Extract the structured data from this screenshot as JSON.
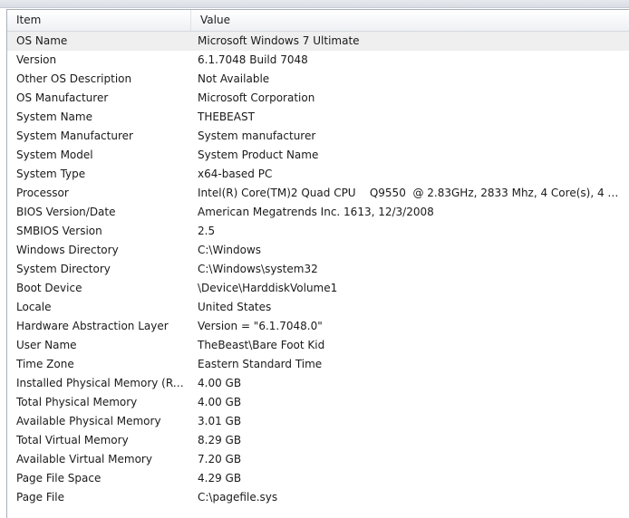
{
  "columns": {
    "item": "Item",
    "value": "Value"
  },
  "rows": [
    {
      "item": "OS Name",
      "value": "Microsoft Windows 7 Ultimate"
    },
    {
      "item": "Version",
      "value": "6.1.7048 Build 7048"
    },
    {
      "item": "Other OS Description",
      "value": "Not Available"
    },
    {
      "item": "OS Manufacturer",
      "value": "Microsoft Corporation"
    },
    {
      "item": "System Name",
      "value": "THEBEAST"
    },
    {
      "item": "System Manufacturer",
      "value": "System manufacturer"
    },
    {
      "item": "System Model",
      "value": "System Product Name"
    },
    {
      "item": "System Type",
      "value": "x64-based PC"
    },
    {
      "item": "Processor",
      "value": "Intel(R) Core(TM)2 Quad CPU    Q9550  @ 2.83GHz, 2833 Mhz, 4 Core(s), 4 Lo..."
    },
    {
      "item": "BIOS Version/Date",
      "value": "American Megatrends Inc. 1613, 12/3/2008"
    },
    {
      "item": "SMBIOS Version",
      "value": "2.5"
    },
    {
      "item": "Windows Directory",
      "value": "C:\\Windows"
    },
    {
      "item": "System Directory",
      "value": "C:\\Windows\\system32"
    },
    {
      "item": "Boot Device",
      "value": "\\Device\\HarddiskVolume1"
    },
    {
      "item": "Locale",
      "value": "United States"
    },
    {
      "item": "Hardware Abstraction Layer",
      "value": "Version = \"6.1.7048.0\""
    },
    {
      "item": "User Name",
      "value": "TheBeast\\Bare Foot Kid"
    },
    {
      "item": "Time Zone",
      "value": "Eastern Standard Time"
    },
    {
      "item": "Installed Physical Memory (RAM)",
      "value": "4.00 GB"
    },
    {
      "item": "Total Physical Memory",
      "value": "4.00 GB"
    },
    {
      "item": "Available Physical Memory",
      "value": "3.01 GB"
    },
    {
      "item": "Total Virtual Memory",
      "value": "8.29 GB"
    },
    {
      "item": "Available Virtual Memory",
      "value": "7.20 GB"
    },
    {
      "item": "Page File Space",
      "value": "4.29 GB"
    },
    {
      "item": "Page File",
      "value": "C:\\pagefile.sys"
    }
  ]
}
